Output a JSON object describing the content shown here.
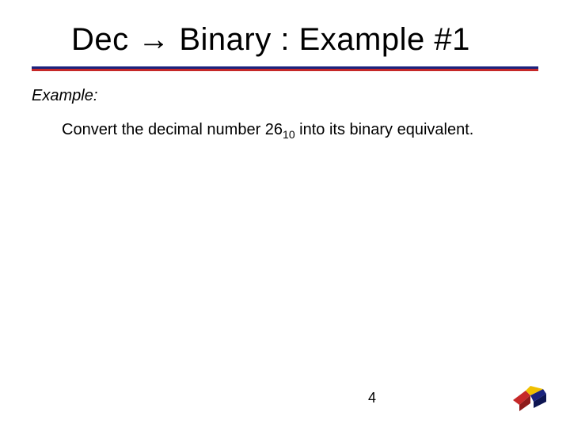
{
  "title": "Dec → Binary : Example #1",
  "example_label": "Example:",
  "body_prefix": "Convert the decimal number 26",
  "body_sub": "10",
  "body_suffix": " into its binary equivalent.",
  "page_number": "4",
  "colors": {
    "underline_top": "#1a237e",
    "underline_bottom": "#c62828"
  }
}
